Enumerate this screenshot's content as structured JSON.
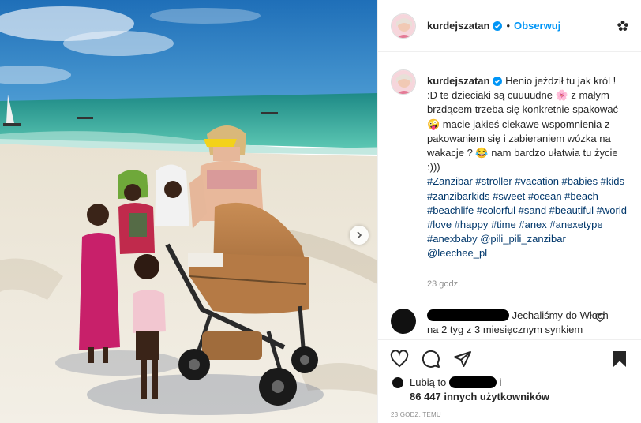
{
  "post": {
    "username": "kurdejszatan",
    "dot": "•",
    "follow_label": "Obserwuj"
  },
  "caption": {
    "username": "kurdejszatan",
    "text": "Henio jeździł tu jak król ! :D te dzieciaki są cuuuudne 🌸 z małym brzdącem trzeba się konkretnie spakować 🤪 macie jakieś ciekawe wspomnienia z pakowaniem się i zabieraniem wózka na wakacje ? 😂 nam bardzo ułatwia tu życie :)))",
    "hashtags": "#Zanzibar #stroller #vacation #babies #kids #zanzibarkids #sweet #ocean #beach #beachlife #colorful #sand #beautiful #world #love #happy #time #anex #anexetype #anexbaby @pili_pili_zanzibar @leechee_pl",
    "time": "23 godz."
  },
  "comment": {
    "text": "Jechaliśmy do Włoch na 2 tyg z 3 miesięcznym synkiem zamierzaliśmy zwiedzać"
  },
  "likes": {
    "prefix": "Lubią to",
    "suffix": "i",
    "count_text": "86 447 innych użytkowników"
  },
  "timestamp": "23 GODZ. TEMU",
  "icons": {
    "verified": "verified-badge-icon",
    "more": "more-options-icon",
    "like": "heart-icon",
    "comment": "comment-icon",
    "share": "paper-plane-icon",
    "save": "bookmark-icon",
    "next": "chevron-right-icon"
  },
  "colors": {
    "accent": "#0095f6",
    "hashtag": "#00376b",
    "muted": "#8e8e8e",
    "border": "#efefef"
  }
}
